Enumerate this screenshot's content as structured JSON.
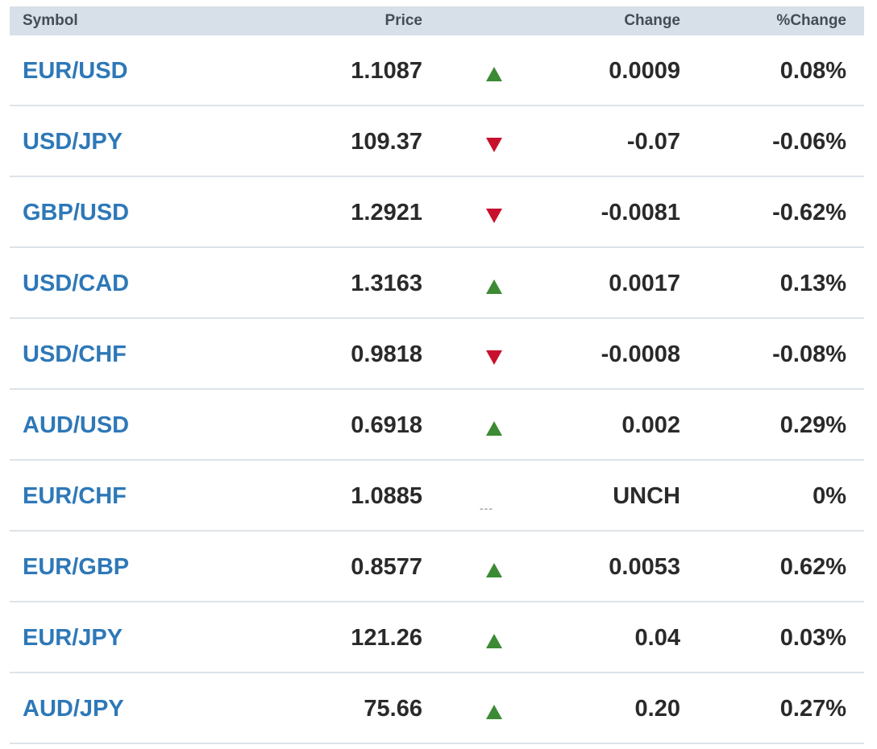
{
  "header": {
    "symbol": "Symbol",
    "price": "Price",
    "change": "Change",
    "pct_change": "%Change"
  },
  "colors": {
    "up": "#3d8a35",
    "down": "#c8102e",
    "link": "#2e78b8",
    "header_bg": "#d7e0e8"
  },
  "rows": [
    {
      "symbol": "EUR/USD",
      "price": "1.1087",
      "direction": "up",
      "change": "0.0009",
      "pct": "0.08%"
    },
    {
      "symbol": "USD/JPY",
      "price": "109.37",
      "direction": "down",
      "change": "-0.07",
      "pct": "-0.06%"
    },
    {
      "symbol": "GBP/USD",
      "price": "1.2921",
      "direction": "down",
      "change": "-0.0081",
      "pct": "-0.62%"
    },
    {
      "symbol": "USD/CAD",
      "price": "1.3163",
      "direction": "up",
      "change": "0.0017",
      "pct": "0.13%"
    },
    {
      "symbol": "USD/CHF",
      "price": "0.9818",
      "direction": "down",
      "change": "-0.0008",
      "pct": "-0.08%"
    },
    {
      "symbol": "AUD/USD",
      "price": "0.6918",
      "direction": "up",
      "change": "0.002",
      "pct": "0.29%"
    },
    {
      "symbol": "EUR/CHF",
      "price": "1.0885",
      "direction": "unchanged",
      "flat_marker": "---",
      "change": "UNCH",
      "pct": "0%"
    },
    {
      "symbol": "EUR/GBP",
      "price": "0.8577",
      "direction": "up",
      "change": "0.0053",
      "pct": "0.62%"
    },
    {
      "symbol": "EUR/JPY",
      "price": "121.26",
      "direction": "up",
      "change": "0.04",
      "pct": "0.03%"
    },
    {
      "symbol": "AUD/JPY",
      "price": "75.66",
      "direction": "up",
      "change": "0.20",
      "pct": "0.27%"
    }
  ]
}
